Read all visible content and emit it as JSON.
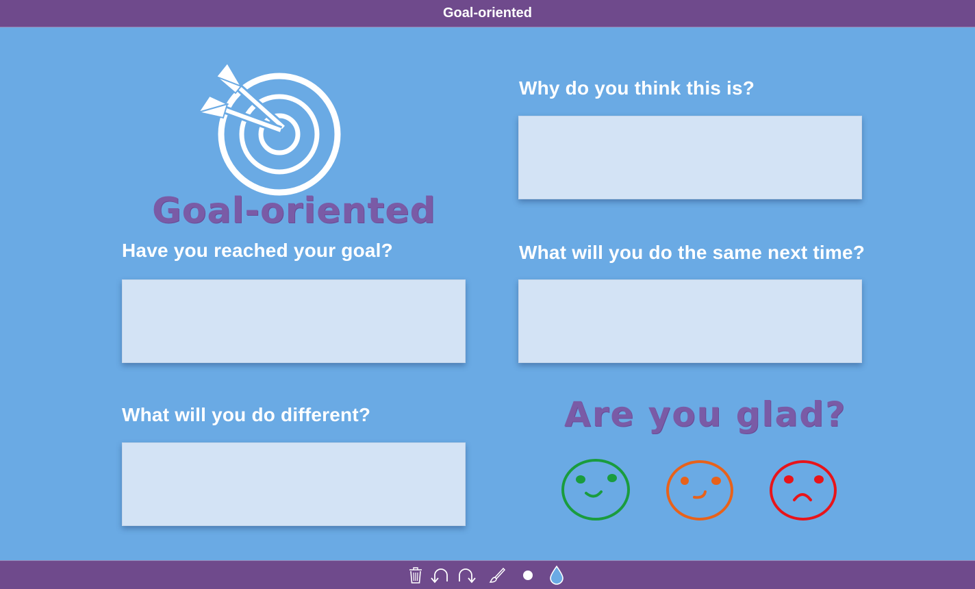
{
  "header": {
    "title": "Goal-oriented"
  },
  "logo": {
    "text": "Goal-oriented",
    "icon": "target-with-darts-icon"
  },
  "questions": {
    "q1": {
      "label": "Have you reached your goal?",
      "value": ""
    },
    "q2": {
      "label": "Why do you think this is?",
      "value": ""
    },
    "q3": {
      "label": "What will you do the same next time?",
      "value": ""
    },
    "q4": {
      "label": "What will you do different?",
      "value": ""
    }
  },
  "glad": {
    "title": "Are you glad?",
    "options": [
      {
        "name": "happy-face-icon",
        "color": "#1a9c3e"
      },
      {
        "name": "neutral-face-icon",
        "color": "#e8621a"
      },
      {
        "name": "sad-face-icon",
        "color": "#e8141a"
      }
    ]
  },
  "toolbar": {
    "tools": [
      "trash-icon",
      "undo-icon",
      "redo-icon",
      "brush-icon",
      "dot-size-icon",
      "color-drop-icon"
    ],
    "drop_color": "#6aaae4"
  },
  "colors": {
    "bar": "#6f4a8c",
    "background": "#6aaae4",
    "box": "#d3e3f5",
    "accent_text": "#7a5ba6"
  }
}
